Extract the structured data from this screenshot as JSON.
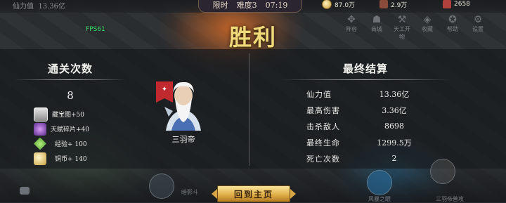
{
  "hud": {
    "top_left_label": "仙力值",
    "top_left_value": "13.36亿",
    "mode": "限时",
    "difficulty": "难度3",
    "timer": "07:19",
    "resources": [
      "87.0万",
      "2.9万",
      "2658"
    ],
    "fps": "FPS61",
    "right_menu": [
      "阵容",
      "商城",
      "天工开物",
      "收藏",
      "帮助",
      "设置"
    ]
  },
  "title": "胜利",
  "left_section": {
    "title": "通关次数",
    "count": "8",
    "rewards": [
      {
        "icon": "treasure-map-icon",
        "text": "藏宝图+50"
      },
      {
        "icon": "talent-fragment-icon",
        "text": "天赋碎片+40"
      },
      {
        "icon": "experience-icon",
        "text": "经验+ 100"
      },
      {
        "icon": "copper-coin-icon",
        "text": "铜币+ 140"
      }
    ]
  },
  "hero": {
    "name": "三羽帝",
    "badge_icon": "bird-emblem-icon"
  },
  "right_section": {
    "title": "最终结算",
    "stats": [
      {
        "label": "仙力值",
        "value": "13.36亿"
      },
      {
        "label": "最高伤害",
        "value": "3.36亿"
      },
      {
        "label": "击杀敌人",
        "value": "8698"
      },
      {
        "label": "最终生命",
        "value": "1299.5万"
      },
      {
        "label": "死亡次数",
        "value": "2"
      }
    ]
  },
  "bottom": {
    "home_button": "回到主页",
    "labels": [
      "暗影斗",
      "风暴之眼",
      "三羽帝普攻"
    ]
  },
  "colors": {
    "title_gold": "#f0da7a",
    "button_gold": "#e1b04a",
    "fps_green": "#38e06a",
    "flag_red": "#c02a2e"
  }
}
